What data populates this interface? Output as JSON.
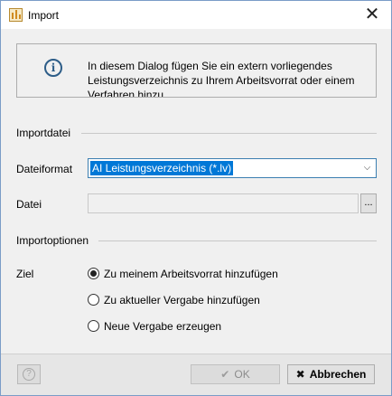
{
  "window": {
    "title": "Import",
    "close_glyph": "✕"
  },
  "info": {
    "icon": "info-icon",
    "glyph": "i",
    "text": "In diesem Dialog fügen Sie ein extern vorliegendes Leistungsverzeichnis zu Ihrem Arbeitsvorrat oder einem Verfahren hinzu"
  },
  "import_file": {
    "section_title": "Importdatei",
    "format_label": "Dateiformat",
    "format_value": "AI Leistungsverzeichnis (*.lv)",
    "file_label": "Datei",
    "file_value": "",
    "browse_label": "..."
  },
  "import_options": {
    "section_title": "Importoptionen",
    "target_label": "Ziel",
    "options": [
      {
        "label": "Zu meinem Arbeitsvorrat hinzufügen",
        "checked": true
      },
      {
        "label": "Zu aktueller Vergabe hinzufügen",
        "checked": false
      },
      {
        "label": "Neue Vergabe erzeugen",
        "checked": false
      }
    ]
  },
  "footer": {
    "help_glyph": "?",
    "ok_glyph": "✔",
    "ok_label": "OK",
    "cancel_glyph": "✖",
    "cancel_label": "Abbrechen"
  },
  "colors": {
    "accent": "#0078d7",
    "info_icon": "#2d5d88"
  }
}
